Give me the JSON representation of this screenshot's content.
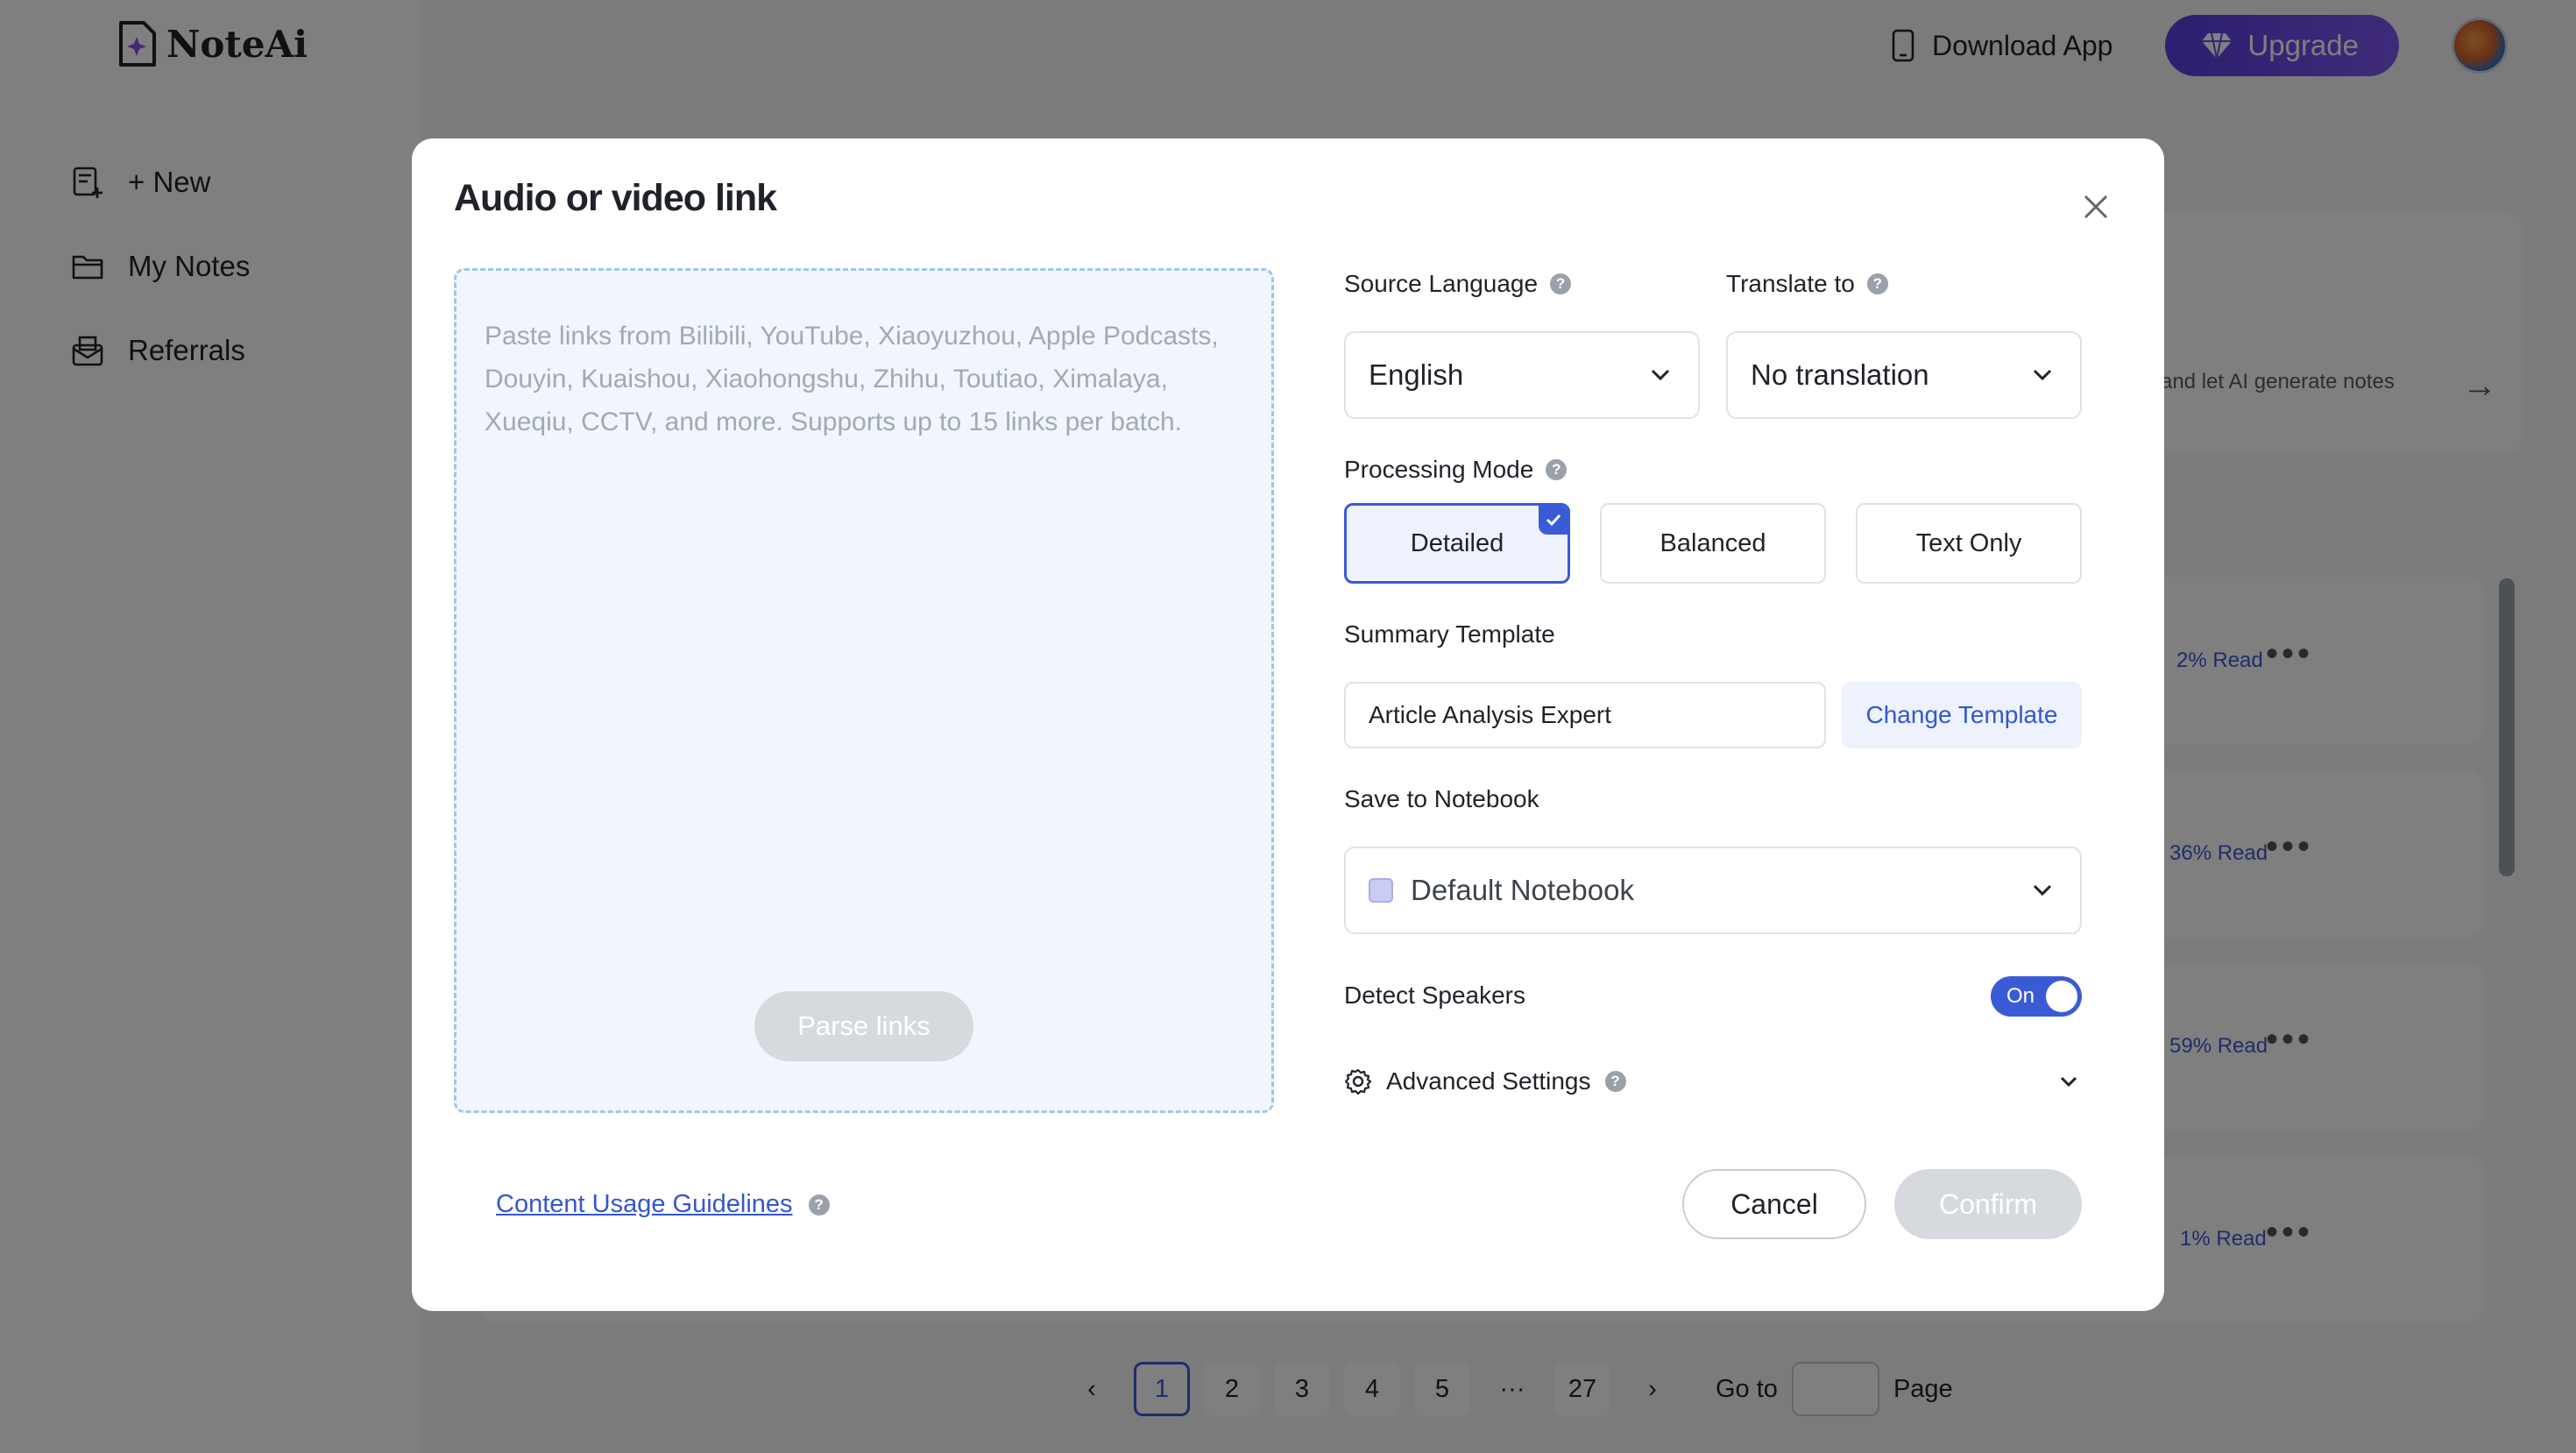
{
  "app": {
    "name": "NoteAi"
  },
  "sidebar": {
    "items": [
      {
        "label": "+ New",
        "icon": "new-note-icon"
      },
      {
        "label": "My Notes",
        "icon": "folder-icon"
      },
      {
        "label": "Referrals",
        "icon": "gift-mail-icon"
      }
    ]
  },
  "header": {
    "download_label": "Download App",
    "upgrade_label": "Upgrade"
  },
  "background": {
    "promo_text": "ses and let AI generate notes",
    "rows": [
      {
        "read": "2% Read"
      },
      {
        "read": "36% Read"
      },
      {
        "read": "59% Read"
      },
      {
        "read": "1% Read"
      }
    ],
    "pagination": {
      "pages": [
        "1",
        "2",
        "3",
        "4",
        "5"
      ],
      "ellipsis": "···",
      "last": "27",
      "current": "1",
      "goto_label": "Go to",
      "page_label": "Page"
    }
  },
  "modal": {
    "title": "Audio or video link",
    "link_placeholder": "Paste links from Bilibili, YouTube, Xiaoyuzhou, Apple Podcasts, Douyin, Kuaishou, Xiaohongshu, Zhihu, Toutiao, Ximalaya, Xueqiu, CCTV, and more. Supports up to 15 links per batch.",
    "parse_label": "Parse links",
    "source_language": {
      "label": "Source Language",
      "value": "English"
    },
    "translate_to": {
      "label": "Translate to",
      "value": "No translation"
    },
    "processing_mode": {
      "label": "Processing Mode",
      "options": [
        "Detailed",
        "Balanced",
        "Text Only"
      ],
      "selected": "Detailed"
    },
    "summary_template": {
      "label": "Summary Template",
      "value": "Article Analysis Expert",
      "change_label": "Change Template"
    },
    "notebook": {
      "label": "Save to Notebook",
      "value": "Default Notebook"
    },
    "detect_speakers": {
      "label": "Detect Speakers",
      "state": "On"
    },
    "advanced_label": "Advanced Settings",
    "guidelines_label": "Content Usage Guidelines",
    "cancel_label": "Cancel",
    "confirm_label": "Confirm"
  },
  "colors": {
    "accent": "#3a5bd6",
    "upgrade_start": "#5b3de0",
    "upgrade_end": "#7d55f2",
    "disabled_button": "#d6d9de",
    "link_area_bg": "#f1f6fd"
  }
}
